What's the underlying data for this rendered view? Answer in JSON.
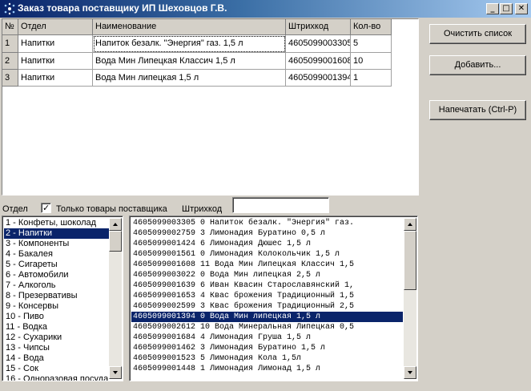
{
  "window": {
    "title": "Заказ товара поставщику ИП Шеховцов Г.В.",
    "minimize_glyph": "_",
    "maximize_glyph": "□",
    "close_glyph": "✕"
  },
  "grid": {
    "headers": [
      "№",
      "Отдел",
      "Наименование",
      "Штрихкод",
      "Кол-во"
    ],
    "rows": [
      {
        "num": "1",
        "dept": "Напитки",
        "name": "Напиток безалк. \"Энергия\" газ. 1,5 л",
        "barcode": "4605099003305",
        "qty": "5"
      },
      {
        "num": "2",
        "dept": "Напитки",
        "name": "Вода Мин Липецкая Классич 1,5 л",
        "barcode": "4605099001608",
        "qty": "10"
      },
      {
        "num": "3",
        "dept": "Напитки",
        "name": "Вода Мин липецкая 1,5 л",
        "barcode": "4605099001394",
        "qty": "1"
      }
    ]
  },
  "buttons": {
    "clear": "Очистить список",
    "add": "Добавить...",
    "print": "Напечатать (Ctrl-P)"
  },
  "filter": {
    "dept_label": "Отдел",
    "only_supplier_label": "Только товары поставщика",
    "only_supplier_checked": true,
    "checkmark": "✓",
    "barcode_label": "Штрихкод",
    "barcode_value": ""
  },
  "departments": {
    "selected_index": 1,
    "items": [
      "1 - Конфеты, шоколад",
      "2 - Напитки",
      "3 - Компоненты",
      "4 - Бакалея",
      "5 - Сигареты",
      "6 - Автомобили",
      "7 - Алкоголь",
      "8 - Презервативы",
      "9 - Консервы",
      "10 - Пиво",
      "11 - Водка",
      "12 - Сухарики",
      "13 - Чипсы",
      "14 - Вода",
      "15 - Сок",
      "16 - Одноразовая посуда"
    ]
  },
  "products": {
    "selected_index": 9,
    "items": [
      "4605099003305    0 Напиток безалк. \"Энергия\" газ.",
      "4605099002759    3 Лимонадия Буратино 0,5 л",
      "4605099001424    6 Лимонадия Дюшес 1,5 л",
      "4605099001561    0 Лимонадия Колокольчик 1,5 л",
      "4605099001608   11 Вода Мин Липецкая Классич 1,5",
      "4605099003022    0 Вода Мин липецкая 2,5 л",
      "4605099001639    6 Иван Квасин Старославянский 1,",
      "4605099001653    4 Квас брожения Традиционный 1,5",
      "4605099002599    3 Квас брожения Традиционный 2,5",
      "4605099001394    0 Вода Мин липецкая 1,5 л",
      "4605099002612   10 Вода Минеральная Липецкая 0,5",
      "4605099001684    4 Лимонадия Груша 1,5 л",
      "4605099001462    3 Лимонадия Буратино 1,5 л",
      "4605099001523    5 Лимонадия Кола 1,5л",
      "4605099001448    1 Лимонадия Лимонад 1,5 л"
    ]
  }
}
